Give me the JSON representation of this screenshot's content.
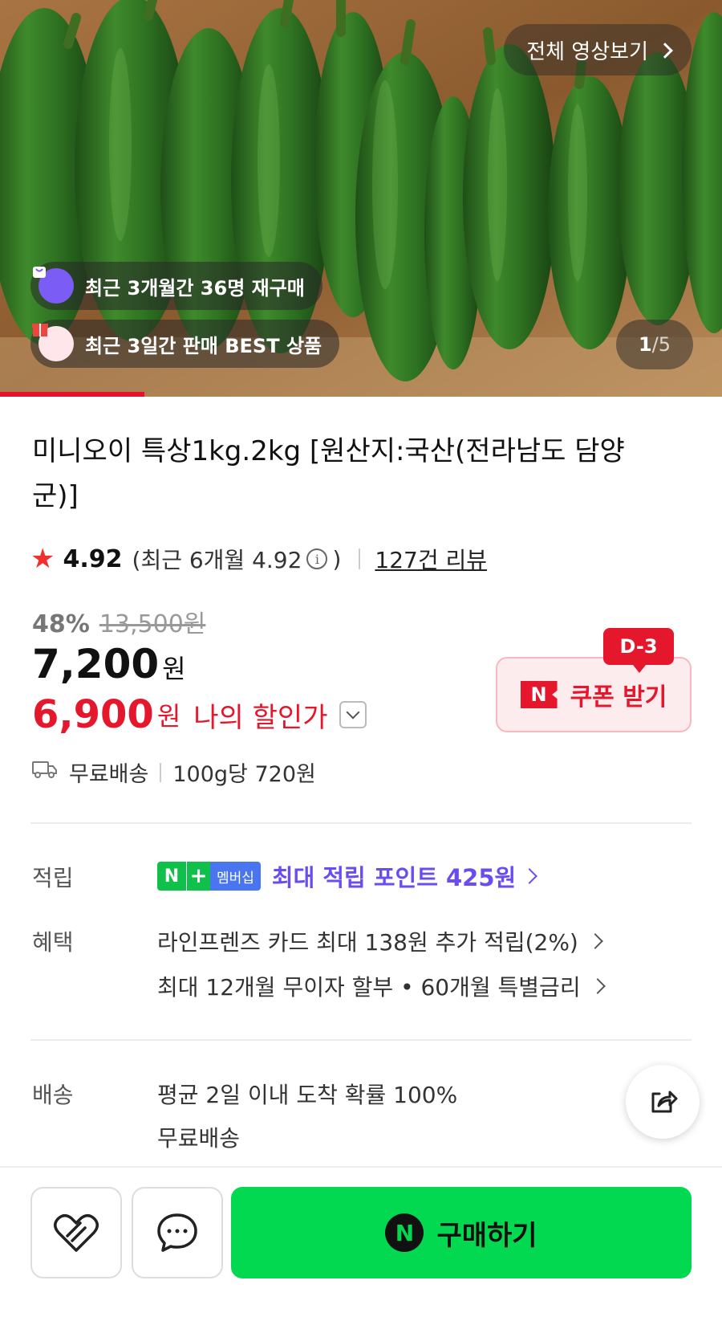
{
  "hero": {
    "video_link_label": "전체 영상보기",
    "badge_rebuy": "최근 3개월간 36명 재구매",
    "badge_best": "최근 3일간 판매 BEST 상품",
    "pager_current": "1",
    "pager_separator": "/",
    "pager_total": "5",
    "progress_fraction": 0.2
  },
  "product": {
    "title": "미니오이 특상1kg.2kg [원산지:국산(전라남도 담양군)]",
    "rating_score": "4.92",
    "rating_recent_label": "(최근 6개월 4.92",
    "rating_recent_close": ")",
    "review_count_link": "127건 리뷰",
    "discount_percent": "48%",
    "original_price": "13,500원",
    "price_value": "7,200",
    "price_unit": "원",
    "my_price_value": "6,900",
    "my_price_unit": "원",
    "my_price_label": "나의 할인가",
    "coupon_dday": "D-3",
    "coupon_logo": "N",
    "coupon_label": "쿠폰 받기",
    "shipping_free": "무료배송",
    "unit_price": "100g당 720원"
  },
  "points": {
    "label": "적립",
    "membership_n": "N",
    "membership_plus": "+",
    "membership_name": "멤버십",
    "text": "최대 적립 포인트 425원"
  },
  "benefits": {
    "label": "혜택",
    "line1": "라인프렌즈 카드 최대 138원 추가 적립(2%)",
    "line2": "최대 12개월 무이자 할부 • 60개월 특별금리"
  },
  "delivery": {
    "label": "배송",
    "line1": "평균 2일 이내 도착 확률 100%",
    "line2": "무료배송"
  },
  "bottom_bar": {
    "buy_logo": "N",
    "buy_label": "구매하기"
  },
  "colors": {
    "accent_red": "#e5172c",
    "buy_green": "#03d950",
    "points_purple": "#6a4df0"
  }
}
